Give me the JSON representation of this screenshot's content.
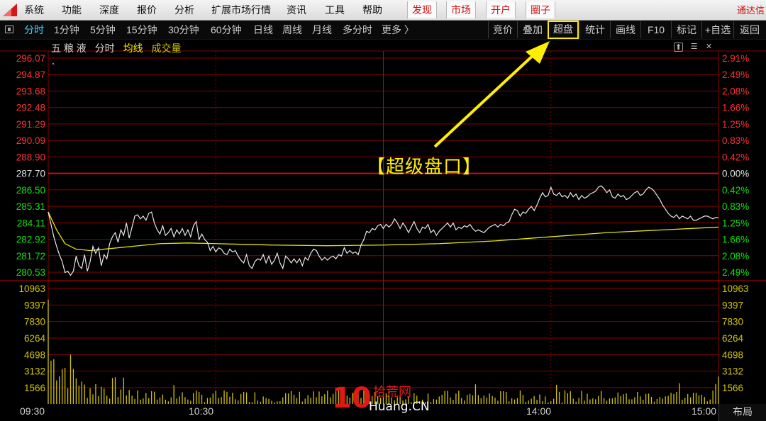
{
  "menubar": {
    "items": [
      "系统",
      "功能",
      "深度",
      "报价",
      "分析",
      "扩展市场行情",
      "资讯",
      "工具",
      "帮助"
    ],
    "special": [
      "发现",
      "市场",
      "开户",
      "圈子"
    ],
    "brand": "通达信"
  },
  "toolbar": {
    "periods": [
      "分时",
      "1分钟",
      "5分钟",
      "15分钟",
      "30分钟",
      "60分钟",
      "日线",
      "周线",
      "月线",
      "多分时",
      "更多 〉"
    ],
    "active_period": "分时",
    "right_buttons": [
      "竞价",
      "叠加",
      "超盘",
      "统计",
      "画线",
      "F10",
      "标记",
      "+自选",
      "返回"
    ],
    "highlighted_button": "超盘"
  },
  "chart_header": {
    "stock_name": "五 粮 液",
    "view": "分时",
    "avg_line_label": "均线",
    "volume_label": "成交量"
  },
  "annotation": "【超级盘口】",
  "colors": {
    "up": "#ff3030",
    "down": "#10e010",
    "flat": "#e0e0e0",
    "volume": "#d4c400",
    "avg_line": "#e6e600",
    "price_line": "#e8e8e8",
    "grid": "#8a0000",
    "highlight": "#ffee00"
  },
  "chart_data": {
    "type": "line",
    "prev_close": 287.7,
    "price_ticks": [
      "296.07",
      "294.87",
      "293.68",
      "292.48",
      "291.29",
      "290.09",
      "288.90",
      "287.70",
      "286.50",
      "285.31",
      "284.11",
      "282.92",
      "281.72",
      "280.53"
    ],
    "pct_ticks": [
      "2.91%",
      "2.49%",
      "2.08%",
      "1.66%",
      "1.25%",
      "0.83%",
      "0.42%",
      "0.00%",
      "0.42%",
      "0.83%",
      "1.25%",
      "1.66%",
      "2.08%",
      "2.49%"
    ],
    "volume_ticks": [
      "10963",
      "9397",
      "7830",
      "6264",
      "4698",
      "3132",
      "1566"
    ],
    "ylim": [
      280.53,
      296.07
    ],
    "volume_max": 10963,
    "time_labels": [
      "09:30",
      "10:30",
      "14:00",
      "15:00"
    ],
    "series": [
      {
        "name": "price",
        "t": [
          0,
          1,
          2,
          3,
          4,
          5,
          6,
          7,
          8,
          9,
          10,
          11,
          12,
          13,
          14,
          15,
          16,
          17,
          18,
          19,
          20,
          21,
          22,
          23,
          24,
          25,
          26,
          27,
          28,
          29,
          30,
          31,
          32,
          33,
          34,
          35,
          36,
          37,
          38,
          39,
          40,
          41,
          42,
          43,
          44,
          45,
          46,
          47,
          48,
          49,
          50,
          51,
          52,
          53,
          54,
          55,
          56,
          57,
          58,
          59,
          60,
          61,
          62,
          63,
          64,
          65,
          66,
          67,
          68,
          69,
          70,
          71,
          72,
          73,
          74,
          75,
          76,
          77,
          78,
          79,
          80,
          81,
          82,
          83,
          84,
          85,
          86,
          87,
          88,
          89,
          90,
          91,
          92,
          93,
          94,
          95,
          96,
          97,
          98,
          99,
          100,
          101,
          102,
          103,
          104,
          105,
          106,
          107,
          108,
          109,
          110,
          111,
          112,
          113,
          114,
          115,
          116,
          117,
          118,
          119,
          120,
          121,
          122,
          123,
          124,
          125,
          126,
          127,
          128,
          129,
          130,
          131,
          132,
          133,
          134,
          135,
          136,
          137,
          138,
          139,
          140,
          141,
          142,
          143,
          144,
          145,
          146,
          147,
          148,
          149,
          150,
          151,
          152,
          153,
          154,
          155,
          156,
          157,
          158,
          159,
          160,
          161,
          162,
          163,
          164,
          165,
          166,
          167,
          168,
          169,
          170,
          171,
          172,
          173,
          174,
          175,
          176,
          177,
          178,
          179,
          180,
          181,
          182,
          183,
          184,
          185,
          186,
          187,
          188,
          189,
          190,
          191,
          192,
          193,
          194,
          195,
          196,
          197,
          198,
          199,
          200,
          201,
          202,
          203,
          204,
          205,
          206,
          207,
          208,
          209,
          210,
          211,
          212,
          213,
          214,
          215,
          216,
          217,
          218,
          219,
          220,
          221,
          222,
          223,
          224,
          225,
          226,
          227,
          228,
          229,
          230,
          231,
          232,
          233,
          234,
          235,
          236,
          237,
          238,
          239,
          240
        ],
        "values": [
          284.9,
          284.0,
          283.1,
          282.4,
          281.8,
          281.3,
          280.5,
          280.6,
          280.3,
          280.6,
          281.7,
          281.0,
          280.8,
          281.8,
          280.6,
          281.3,
          282.4,
          281.9,
          282.3,
          281.0,
          281.8,
          281.5,
          282.6,
          283.1,
          283.4,
          282.7,
          283.6,
          283.2,
          284.1,
          283.0,
          283.8,
          284.6,
          284.7,
          284.4,
          284.6,
          284.3,
          284.8,
          284.9,
          284.1,
          283.6,
          283.3,
          283.9,
          283.2,
          283.4,
          283.7,
          283.1,
          283.6,
          283.3,
          283.7,
          283.2,
          283.6,
          283.1,
          283.9,
          284.2,
          282.9,
          283.3,
          282.9,
          282.7,
          282.1,
          282.4,
          282.0,
          282.3,
          282.2,
          281.9,
          281.8,
          282.2,
          282.0,
          282.1,
          281.7,
          281.4,
          281.2,
          281.8,
          281.0,
          280.8,
          281.3,
          281.5,
          281.4,
          281.8,
          281.2,
          281.7,
          281.1,
          281.4,
          281.9,
          281.2,
          280.8,
          281.7,
          281.5,
          281.2,
          281.5,
          281.2,
          281.5,
          281.0,
          281.6,
          281.4,
          281.9,
          282.2,
          282.1,
          281.7,
          281.4,
          281.6,
          281.4,
          281.6,
          281.7,
          281.5,
          281.8,
          281.7,
          282.3,
          281.9,
          282.1,
          281.9,
          282.0,
          281.8,
          282.5,
          282.9,
          283.5,
          283.4,
          283.7,
          283.6,
          283.9,
          284.0,
          283.7,
          284.0,
          283.8,
          284.0,
          284.4,
          284.1,
          283.7,
          284.1,
          283.8,
          283.4,
          283.8,
          284.2,
          283.7,
          283.4,
          283.8,
          283.7,
          284.0,
          283.4,
          283.6,
          283.2,
          283.5,
          283.7,
          283.9,
          284.1,
          283.8,
          284.1,
          283.6,
          283.8,
          283.7,
          283.9,
          283.8,
          284.0,
          283.7,
          283.5,
          283.6,
          283.5,
          283.4,
          283.6,
          283.8,
          283.9,
          284.0,
          283.8,
          284.0,
          283.9,
          284.1,
          284.2,
          284.7,
          285.1,
          285.0,
          284.6,
          284.9,
          284.8,
          285.1,
          285.3,
          285.0,
          285.4,
          285.9,
          286.3,
          286.0,
          286.1,
          286.7,
          286.2,
          286.1,
          286.3,
          286.0,
          286.1,
          285.9,
          286.3,
          286.0,
          286.2,
          285.8,
          286.1,
          285.9,
          286.0,
          286.2,
          286.3,
          286.4,
          286.7,
          286.8,
          286.6,
          286.3,
          286.5,
          286.0,
          285.9,
          286.2,
          286.0,
          286.1,
          285.8,
          285.9,
          286.1,
          286.3,
          286.4,
          286.1,
          286.2,
          286.5,
          286.7,
          286.6,
          286.4,
          286.1,
          285.8,
          285.4,
          285.1,
          284.8,
          284.6,
          284.5,
          284.7,
          284.4,
          284.6,
          284.5,
          284.4,
          284.6,
          284.3,
          284.3,
          284.4,
          284.5,
          284.6,
          284.6,
          284.5,
          284.4,
          284.5,
          284.5
        ]
      },
      {
        "name": "avg",
        "t": [
          0,
          3,
          6,
          10,
          15,
          20,
          30,
          40,
          50,
          60,
          80,
          100,
          120,
          140,
          160,
          180,
          200,
          220,
          240
        ],
        "values": [
          284.9,
          283.6,
          282.6,
          282.2,
          282.1,
          282.2,
          282.4,
          282.6,
          282.65,
          282.6,
          282.5,
          282.45,
          282.5,
          282.6,
          282.8,
          283.1,
          283.4,
          283.6,
          283.8
        ]
      }
    ]
  }
}
